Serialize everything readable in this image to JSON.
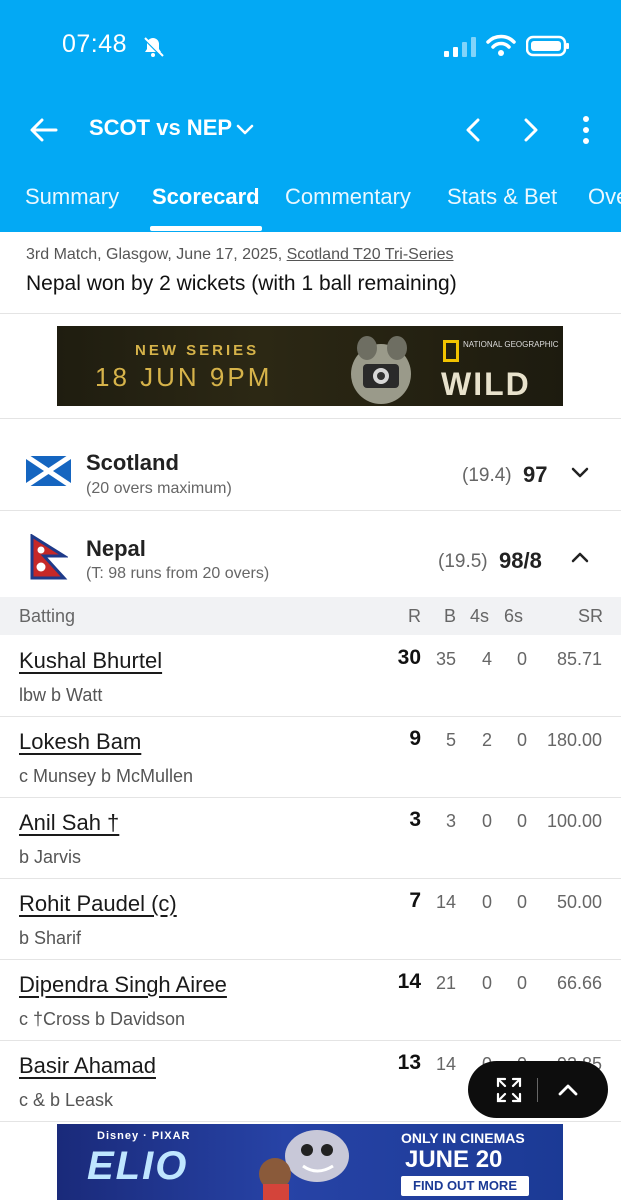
{
  "status_bar": {
    "time": "07:48"
  },
  "header": {
    "title": "SCOT vs NEP",
    "tabs": [
      {
        "label": "Summary",
        "active": false
      },
      {
        "label": "Scorecard",
        "active": true
      },
      {
        "label": "Commentary",
        "active": false
      },
      {
        "label": "Stats & Bet",
        "active": false
      },
      {
        "label": "Ove",
        "active": false
      }
    ]
  },
  "match": {
    "meta": "3rd Match, Glasgow, June 17, 2025, ",
    "series_link": "Scotland T20 Tri-Series",
    "result": "Nepal won by 2 wickets (with 1 ball remaining)"
  },
  "ad_top": {
    "line1": "NEW SERIES",
    "line2": "18 JUN 9PM",
    "brand_small": "NATIONAL GEOGRAPHIC",
    "brand_big": "WILD"
  },
  "teams": [
    {
      "name": "Scotland",
      "sub": "(20 overs maximum)",
      "overs": "(19.4)",
      "score": "97",
      "expanded": false
    },
    {
      "name": "Nepal",
      "sub": "(T: 98 runs from 20 overs)",
      "overs": "(19.5)",
      "score": "98/8",
      "expanded": true
    }
  ],
  "batting": {
    "headers": {
      "batting": "Batting",
      "r": "R",
      "b": "B",
      "fours": "4s",
      "sixes": "6s",
      "sr": "SR"
    },
    "rows": [
      {
        "name": "Kushal Bhurtel",
        "dismissal": "lbw b Watt",
        "r": "30",
        "b": "35",
        "fours": "4",
        "sixes": "0",
        "sr": "85.71"
      },
      {
        "name": "Lokesh Bam",
        "dismissal": "c Munsey b McMullen",
        "r": "9",
        "b": "5",
        "fours": "2",
        "sixes": "0",
        "sr": "180.00"
      },
      {
        "name": "Anil Sah †",
        "dismissal": " b Jarvis",
        "r": "3",
        "b": "3",
        "fours": "0",
        "sixes": "0",
        "sr": "100.00"
      },
      {
        "name": "Rohit Paudel (c)",
        "dismissal": " b Sharif",
        "r": "7",
        "b": "14",
        "fours": "0",
        "sixes": "0",
        "sr": "50.00"
      },
      {
        "name": "Dipendra Singh Airee",
        "dismissal": "c †Cross b Davidson",
        "r": "14",
        "b": "21",
        "fours": "0",
        "sixes": "0",
        "sr": "66.66"
      },
      {
        "name": "Basir Ahamad",
        "dismissal": "c & b Leask",
        "r": "13",
        "b": "14",
        "fours": "0",
        "sixes": "0",
        "sr": "92.85"
      }
    ]
  },
  "ad_bottom": {
    "brand": "Disney · PIXAR",
    "title": "ELIO",
    "tagline": "ONLY IN CINEMAS",
    "date": "JUNE 20",
    "cta": "FIND OUT MORE"
  },
  "colors": {
    "header_bg": "#03a9f4",
    "table_head_bg": "#f1f2f4",
    "fab_bg": "#0d0d0d"
  }
}
